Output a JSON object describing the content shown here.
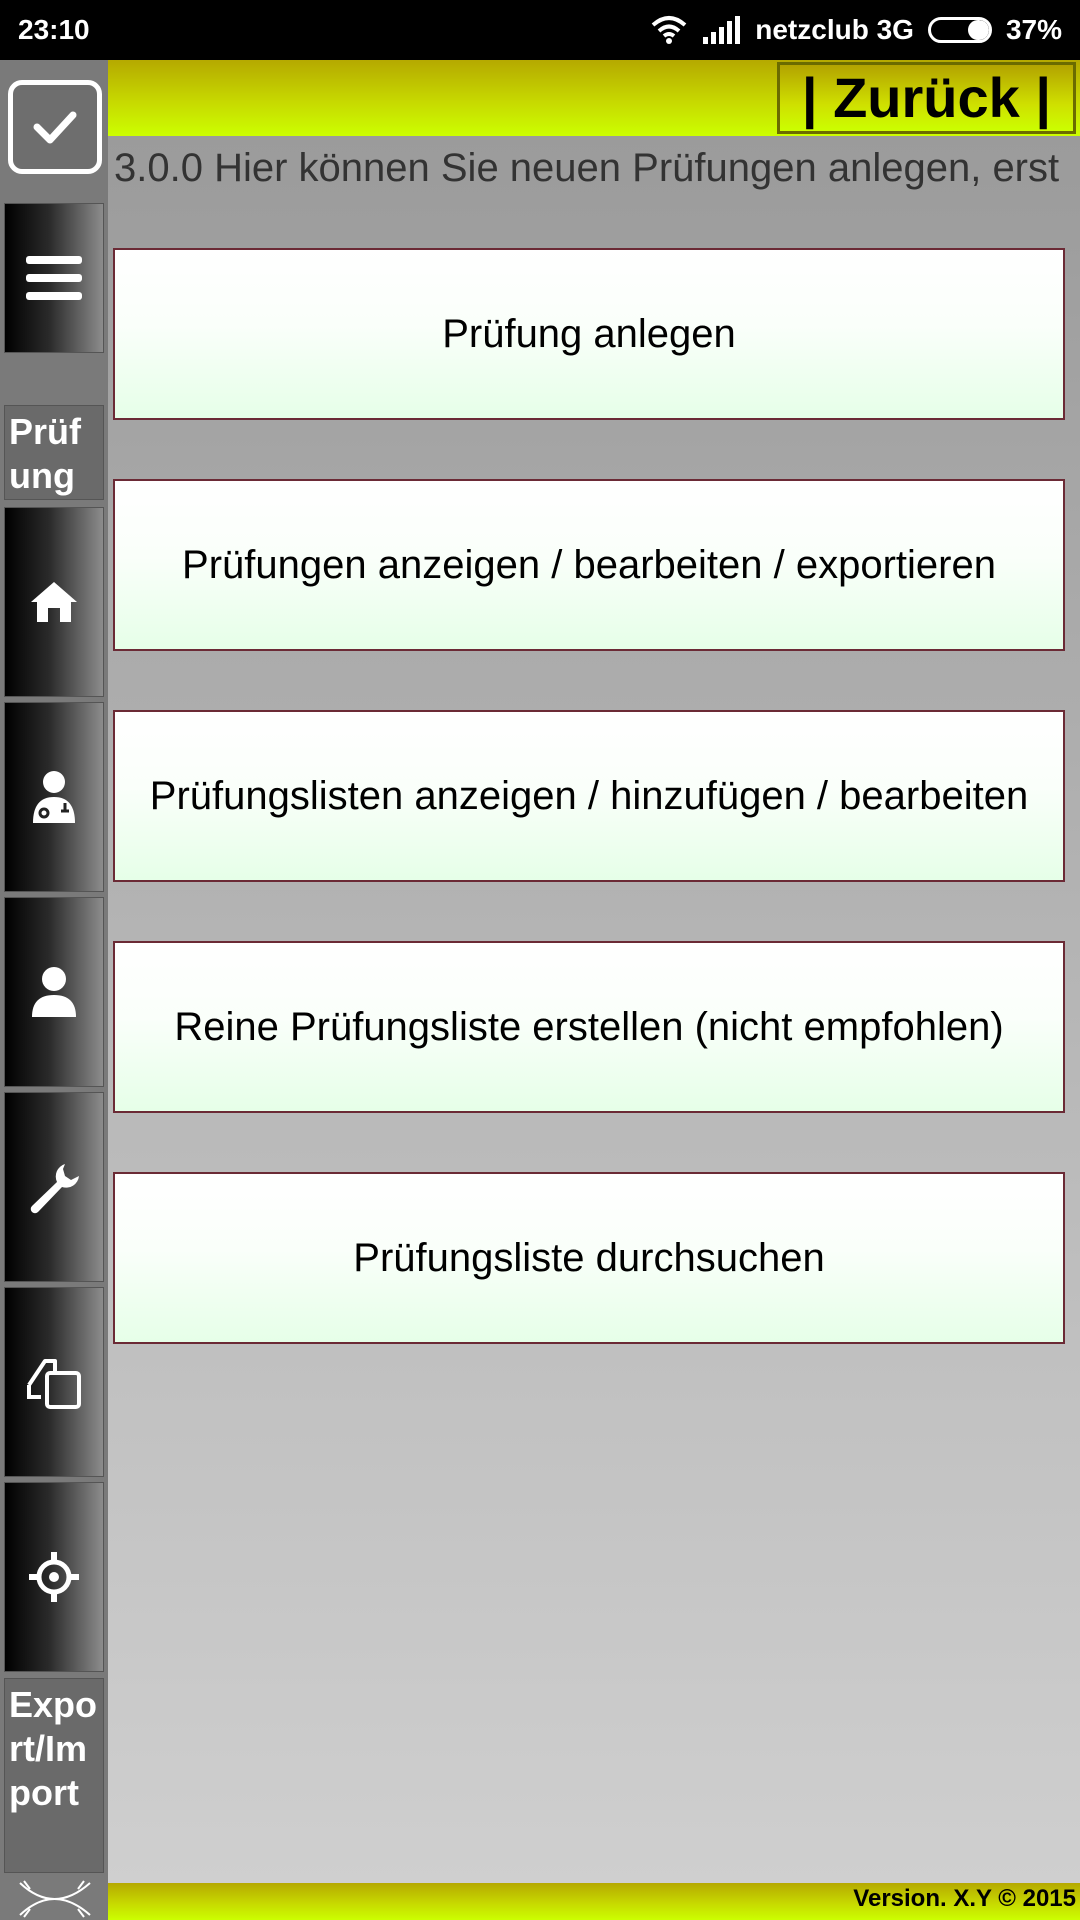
{
  "statusbar": {
    "time": "23:10",
    "carrier": "netzclub 3G",
    "battery": "37%",
    "battery_level": 0.37,
    "icons": [
      "wifi-icon",
      "signal-icon",
      "battery-icon"
    ]
  },
  "header": {
    "back_label": "| Zurück |",
    "logo_icon": "checkbox-check-icon"
  },
  "sidebar": {
    "menu_icon": "hamburger-menu-icon",
    "section_label": "Prüfung",
    "items": [
      {
        "icon": "home-icon"
      },
      {
        "icon": "doctor-icon"
      },
      {
        "icon": "user-icon"
      },
      {
        "icon": "wrench-icon"
      },
      {
        "icon": "copy-documents-icon"
      },
      {
        "icon": "crosshair-icon"
      }
    ],
    "bottom_label": "Export/Import",
    "bottom_icon": "crossed-lines-icon"
  },
  "main": {
    "info_text": "3.0.0 Hier können Sie neuen Prüfungen anlegen, erst",
    "buttons": [
      "Prüfung anlegen",
      "Prüfungen anzeigen / bearbeiten / exportieren",
      "Prüfungslisten anzeigen / hinzufügen / bearbeiten",
      "Reine Prüfungsliste erstellen (nicht empfohlen)",
      "Prüfungsliste durchsuchen"
    ]
  },
  "footer": {
    "version": "Version. X.Y © 2015"
  },
  "colors": {
    "accent_yellow": "#ccff00",
    "button_border": "#6b2a35",
    "statusbar_bg": "#000000"
  }
}
